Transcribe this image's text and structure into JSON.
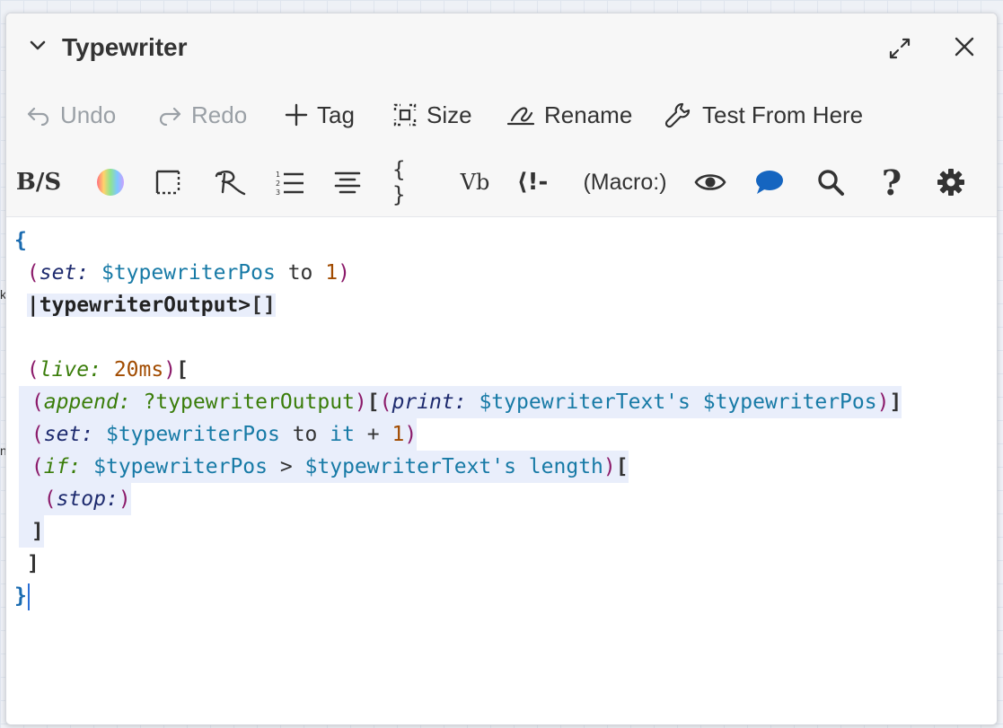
{
  "dialog": {
    "title": "Typewriter"
  },
  "toolbar": {
    "undo": "Undo",
    "redo": "Redo",
    "tag": "Tag",
    "size": "Size",
    "rename": "Rename",
    "test": "Test From Here"
  },
  "format_toolbar": {
    "bold_strike": "B/S",
    "macro": "(Macro:)",
    "vb": "Vb",
    "braces": "{ }",
    "comment": "⟨!-",
    "help": "?"
  },
  "code": {
    "l1_brace": "{",
    "l2_macro": "set:",
    "l2_var": "$typewriterPos",
    "l2_to": " to ",
    "l2_num": "1",
    "l3_nametag": "|typewriterOutput>",
    "l3_hook": "[]",
    "l5_macro": "live:",
    "l5_num": "20ms",
    "l6_macro": "append:",
    "l6_name": "?typewriterOutput",
    "l6_macro2": "print:",
    "l6_var1": "$typewriterText's",
    "l6_var2": "$typewriterPos",
    "l7_macro": "set:",
    "l7_var": "$typewriterPos",
    "l7_to": " to ",
    "l7_it": "it",
    "l7_plus": " + ",
    "l7_num": "1",
    "l8_macro": "if:",
    "l8_var1": "$typewriterPos",
    "l8_op": " > ",
    "l8_var2": "$typewriterText's",
    "l8_len": " length",
    "l9_macro": "stop:",
    "close_hook": "]",
    "close_brace": "}"
  },
  "background": {
    "frag1": "k",
    "frag2": "n"
  },
  "colors": {
    "accent_blue": "#2a6ed6",
    "macro_purple": "#8b1a6a",
    "variable_teal": "#177aa6",
    "number_orange": "#a14b00"
  }
}
